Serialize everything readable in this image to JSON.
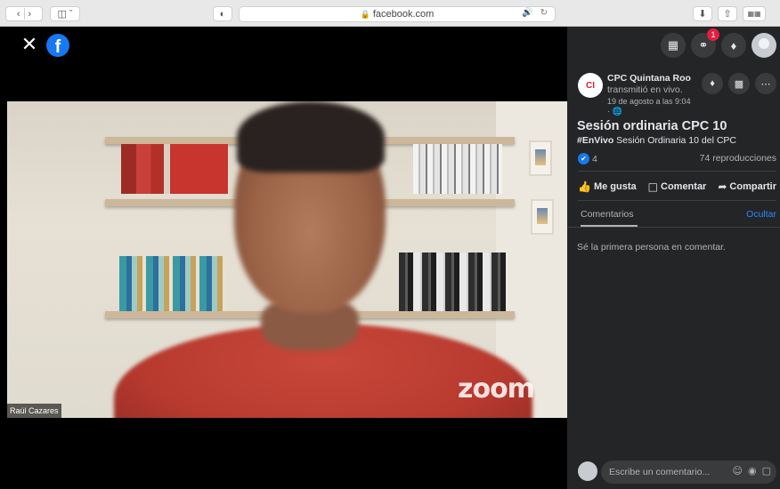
{
  "browser": {
    "url": "facebook.com",
    "back_icon": "chevron-left-icon",
    "forward_icon": "chevron-right-icon",
    "sidebar_icon": "sidebar-icon",
    "shield_icon": "privacy-shield-icon",
    "audio_icon": "speaker-icon",
    "reload_icon": "reload-icon",
    "download_icon": "download-icon",
    "share_icon": "share-icon",
    "tabs_icon": "tab-overview-icon"
  },
  "video": {
    "participant_name": "Raúl Cazares",
    "watermark": "zoom"
  },
  "sidebar": {
    "notifications": {
      "messenger_badge": "1"
    },
    "page": {
      "avatar_text": "CI",
      "name": "CPC Quintana Roo",
      "subtitle": "transmitió en vivo.",
      "date": "19 de agosto a las 9:04",
      "visibility": "· 🌐"
    },
    "post": {
      "title": "Sesión ordinaria CPC 10",
      "hashtag": "#EnVivo",
      "description": " Sesión Ordinaria 10 del CPC",
      "reaction_count": "4",
      "views": "74 reproducciones"
    },
    "actions": {
      "like": "Me gusta",
      "comment": "Comentar",
      "share": "Compartir"
    },
    "comments": {
      "tab_label": "Comentarios",
      "hide_label": "Ocultar",
      "empty_message": "Sé la primera persona en comentar.",
      "input_placeholder": "Escribe un comentario..."
    }
  },
  "colors": {
    "sidebar_bg": "#242526",
    "accent_blue": "#1877f2",
    "link_blue": "#2d88ff",
    "badge_red": "#e41e3f"
  }
}
